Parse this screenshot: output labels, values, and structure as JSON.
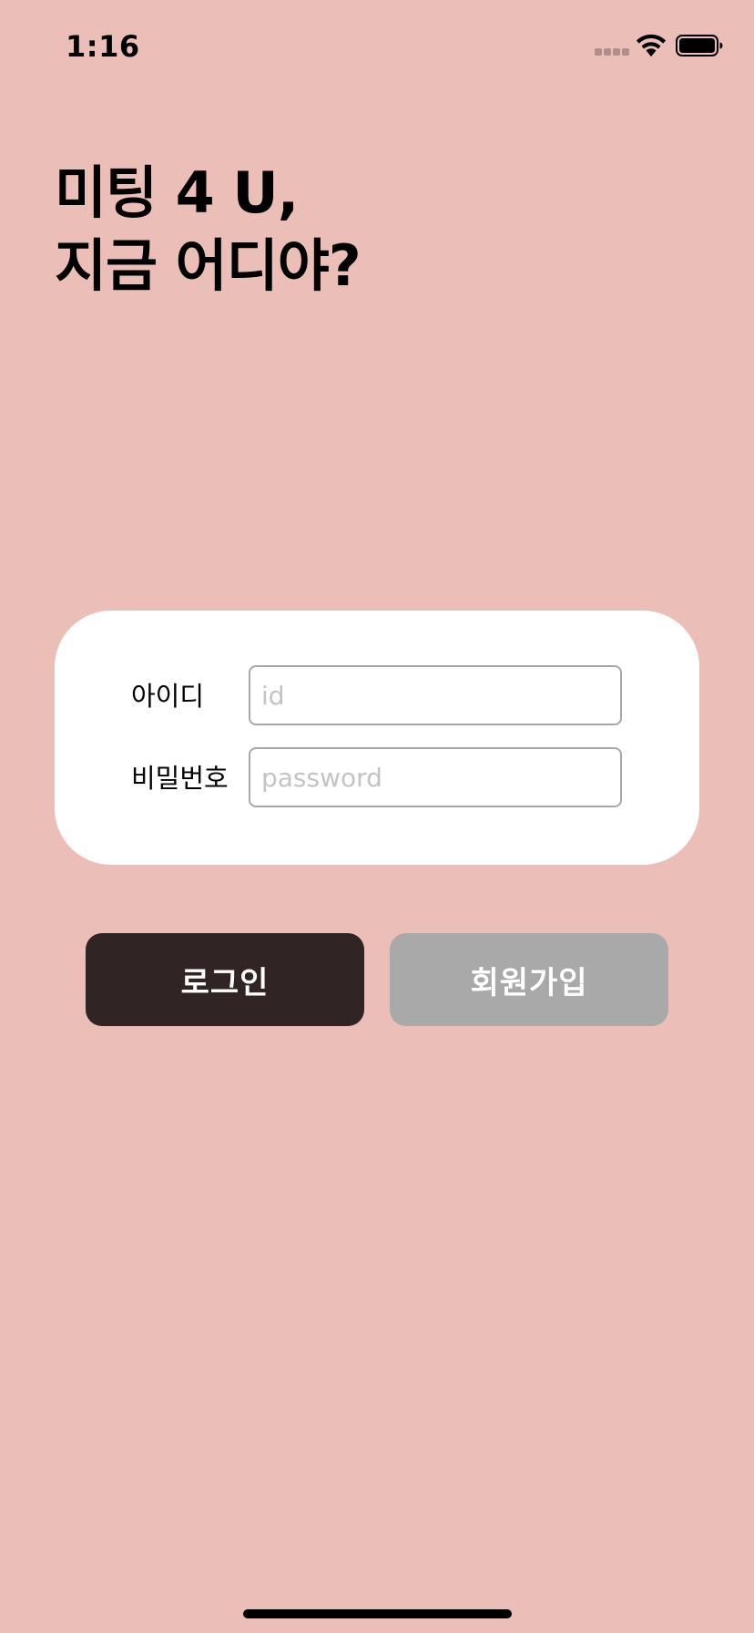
{
  "status_bar": {
    "time": "1:16",
    "icons": [
      "cellular-signal-icon",
      "wifi-icon",
      "battery-icon"
    ]
  },
  "headline": {
    "line1": "미팅 4 U,",
    "line2": "지금 어디야?"
  },
  "login_form": {
    "id_label": "아이디",
    "id_placeholder": "id",
    "id_value": "",
    "password_label": "비밀번호",
    "password_placeholder": "password",
    "password_value": ""
  },
  "buttons": {
    "login_label": "로그인",
    "signup_label": "회원가입"
  },
  "colors": {
    "background": "#EBBFB8",
    "card": "#FFFFFF",
    "login_button": "#302524",
    "signup_button": "#A9A9A9",
    "placeholder_text": "#C4C4C4"
  }
}
